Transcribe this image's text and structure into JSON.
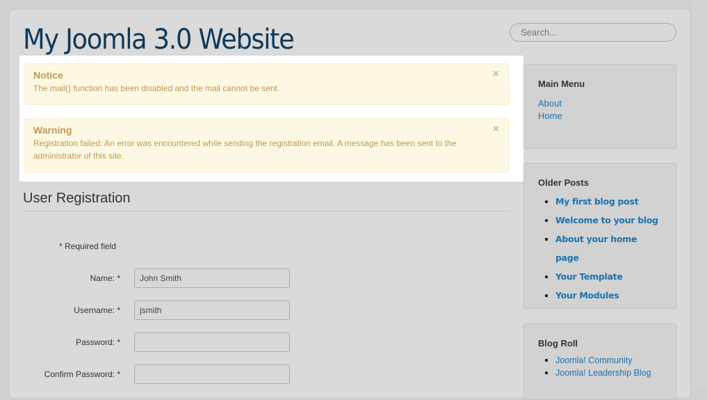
{
  "header": {
    "title": "My Joomla 3.0 Website",
    "search_placeholder": "Search..."
  },
  "alerts": [
    {
      "heading": "Notice",
      "message": "The mail() function has been disabled and the mail cannot be sent.",
      "close": "×"
    },
    {
      "heading": "Warning",
      "message": "Registration failed: An error was encountered while sending the registration email. A message has been sent to the administrator of this site.",
      "close": "×"
    }
  ],
  "form": {
    "title": "User Registration",
    "required_note": "* Required field",
    "fields": [
      {
        "label": "Name: *",
        "value": "John Smith"
      },
      {
        "label": "Username: *",
        "value": "jsmith"
      },
      {
        "label": "Password: *",
        "value": ""
      },
      {
        "label": "Confirm Password: *",
        "value": ""
      }
    ]
  },
  "sidebar": {
    "main_menu": {
      "title": "Main Menu",
      "items": [
        "About",
        "Home"
      ]
    },
    "older_posts": {
      "title": "Older Posts",
      "items": [
        "My first blog post",
        "Welcome to your blog",
        "About your home page",
        "Your Template",
        "Your Modules"
      ]
    },
    "blog_roll": {
      "title": "Blog Roll",
      "items": [
        "Joomla! Community",
        "Joomla! Leadership Blog"
      ]
    }
  },
  "colors": {
    "title": "#0e3a5a",
    "link": "#1a73b0",
    "alert_bg": "#fcf8e3",
    "alert_text": "#c09853"
  }
}
